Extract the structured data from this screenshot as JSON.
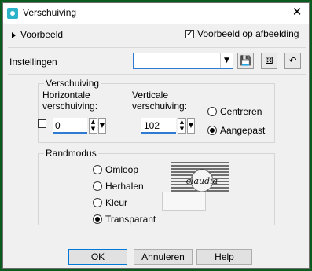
{
  "window": {
    "title": "Verschuiving",
    "close": "✕"
  },
  "preview": {
    "toggle_label": "Voorbeeld",
    "on_image_label": "Voorbeeld op afbeelding",
    "on_image_checked": true
  },
  "settings": {
    "label": "Instellingen",
    "preset_value": ""
  },
  "offset": {
    "group_title": "Verschuiving",
    "horizontal_label_1": "Horizontale",
    "horizontal_label_2": "verschuiving:",
    "horizontal_value": "0",
    "vertical_label_1": "Verticale",
    "vertical_label_2": "verschuiving:",
    "vertical_value": "102",
    "center_label": "Centreren",
    "custom_label": "Aangepast",
    "selected": "custom"
  },
  "edge_mode": {
    "group_title": "Randmodus",
    "options": [
      "Omloop",
      "Herhalen",
      "Kleur",
      "Transparant"
    ],
    "selected": "Transparant",
    "watermark": "claudia"
  },
  "buttons": {
    "ok": "OK",
    "cancel": "Annuleren",
    "help": "Help"
  },
  "colors": {
    "frame": "#0a5c1e",
    "accent": "#0078d7",
    "dialog_bg": "#f0f0f0"
  }
}
